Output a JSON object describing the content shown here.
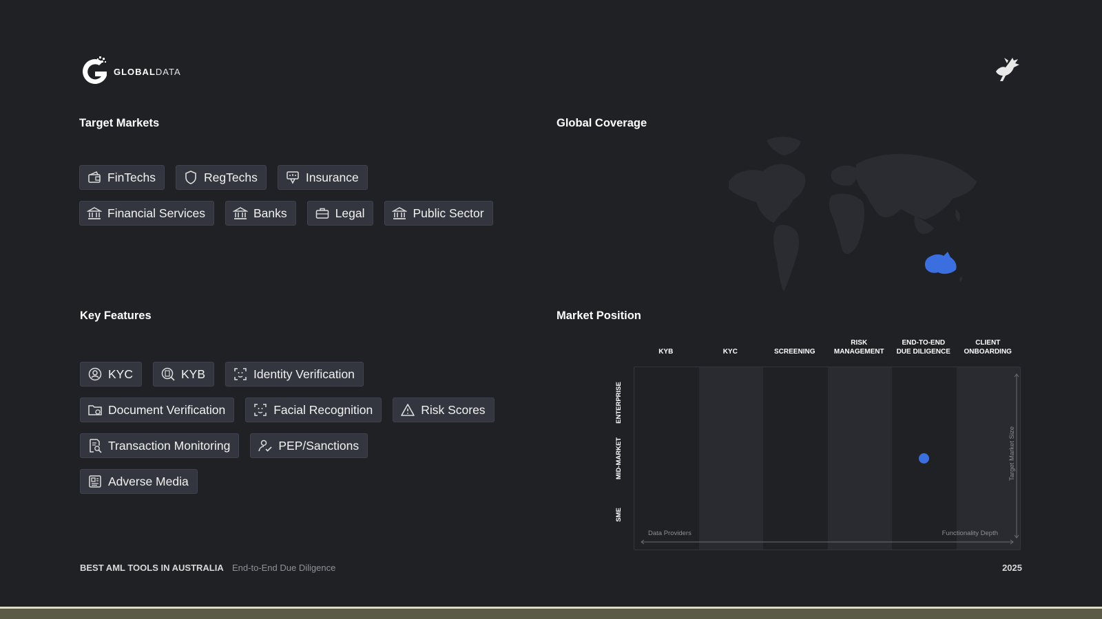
{
  "brand": {
    "name_bold": "GLOBAL",
    "name_light": "DATA"
  },
  "target_markets": {
    "title": "Target Markets",
    "items": [
      {
        "label": "FinTechs",
        "icon": "wallet-icon"
      },
      {
        "label": "RegTechs",
        "icon": "shield-icon"
      },
      {
        "label": "Insurance",
        "icon": "insurance-icon"
      },
      {
        "label": "Financial Services",
        "icon": "bank-icon"
      },
      {
        "label": "Banks",
        "icon": "bank-icon"
      },
      {
        "label": "Legal",
        "icon": "briefcase-icon"
      },
      {
        "label": "Public Sector",
        "icon": "bank-icon"
      }
    ]
  },
  "global_coverage": {
    "title": "Global Coverage",
    "highlight_region": "Australia",
    "highlight_color": "#3b6fe0"
  },
  "key_features": {
    "title": "Key Features",
    "items": [
      {
        "label": "KYC",
        "icon": "user-search-icon"
      },
      {
        "label": "KYB",
        "icon": "building-search-icon"
      },
      {
        "label": "Identity Verification",
        "icon": "face-scan-icon"
      },
      {
        "label": "Document Verification",
        "icon": "folder-icon"
      },
      {
        "label": "Facial Recognition",
        "icon": "face-scan-icon"
      },
      {
        "label": "Risk Scores",
        "icon": "warning-icon"
      },
      {
        "label": "Transaction Monitoring",
        "icon": "document-search-icon"
      },
      {
        "label": "PEP/Sanctions",
        "icon": "user-check-icon"
      },
      {
        "label": "Adverse Media",
        "icon": "newspaper-icon"
      }
    ]
  },
  "market_position": {
    "title": "Market Position",
    "columns": [
      "KYB",
      "KYC",
      "SCREENING",
      "RISK\nMANAGEMENT",
      "END-TO-END\nDUE DILIGENCE",
      "CLIENT\nONBOARDING"
    ],
    "rows": [
      "ENTERPRISE",
      "MID-MARKET",
      "SME"
    ],
    "x_note_left": "Data Providers",
    "x_note_right": "Functionality Depth",
    "y_note": "Target Market Size",
    "point": {
      "column": "END-TO-END\nDUE DILIGENCE",
      "row": "MID-MARKET",
      "color": "#3b6fe0"
    }
  },
  "footer": {
    "title": "BEST AML TOOLS IN AUSTRALIA",
    "subtitle": "End-to-End Due Diligence",
    "year": "2025"
  }
}
